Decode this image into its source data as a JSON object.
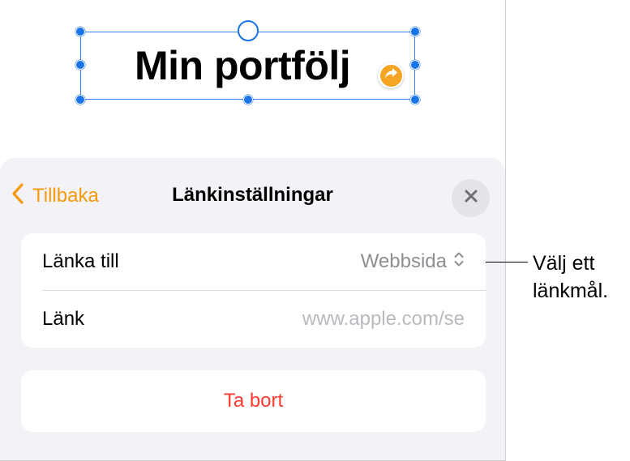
{
  "slide": {
    "title_text": "Min portfölj",
    "link_badge_icon": "share-arrow-icon"
  },
  "popover": {
    "back_label": "Tillbaka",
    "title": "Länkinställningar",
    "close_icon": "close-icon",
    "rows": [
      {
        "label": "Länka till",
        "value": "Webbsida"
      },
      {
        "label": "Länk",
        "value": "www.apple.com/se"
      }
    ],
    "delete_label": "Ta bort"
  },
  "callout": {
    "line1": "Välj ett",
    "line2": "länkmål."
  },
  "colors": {
    "accent": "#f59a0c",
    "destructive": "#ff3b30",
    "selection": "#1a73e8",
    "sheet_background": "#f2f2f7"
  }
}
